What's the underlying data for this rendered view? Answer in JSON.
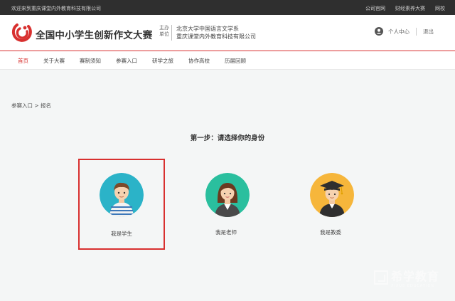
{
  "topbar": {
    "welcome": "欢迎来到重庆课堂内外教育科技有限公司",
    "links": [
      "公司官网",
      "财经素养大赛",
      "网校"
    ]
  },
  "header": {
    "title": "全国中小学生创新作文大赛",
    "host_label": "主办单位",
    "host_orgs": [
      "北京大学中国语言文学系",
      "重庆课堂内外教育科技有限公司"
    ],
    "user_center": "个人中心",
    "logout": "退出"
  },
  "nav": {
    "items": [
      "首页",
      "关于大赛",
      "赛制须知",
      "参赛入口",
      "研学之旅",
      "协作高校",
      "历届回顾"
    ],
    "active": "首页"
  },
  "breadcrumb": "参赛入口 > 报名",
  "step_title": "第一步：请选择你的身份",
  "roles": [
    {
      "label": "我是学生",
      "selected": true
    },
    {
      "label": "我是老师",
      "selected": false
    },
    {
      "label": "我是教委",
      "selected": false
    }
  ],
  "watermark": {
    "cn": "希学教育",
    "en": "XIXUE EDUCATION"
  },
  "colors": {
    "accent": "#d8302f",
    "student_bg": "#2bb3c8",
    "teacher_bg": "#2abf9e",
    "commission_bg": "#f6b63b"
  }
}
